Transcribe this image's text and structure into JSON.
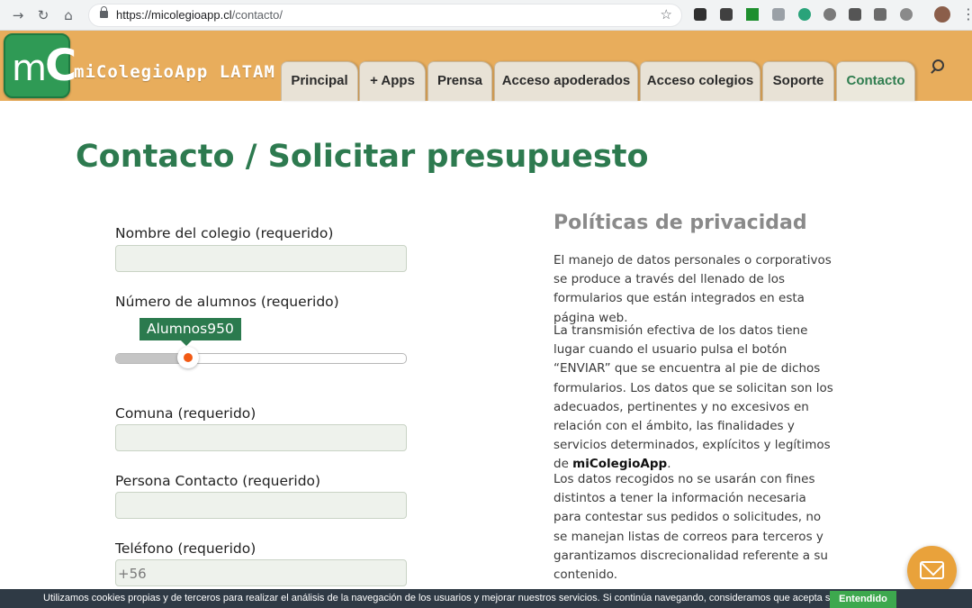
{
  "browser": {
    "url_host": "https://micolegioapp.cl",
    "url_path": "/contacto/",
    "back_icon": "back-arrow-icon",
    "reload_icon": "reload-icon",
    "home_icon": "home-icon"
  },
  "site": {
    "logo_letters_small": "m",
    "logo_letters_big": "C",
    "brand_name": "miColegioApp LATAM",
    "nav": [
      {
        "label": "Principal"
      },
      {
        "label": "+ Apps"
      },
      {
        "label": "Prensa"
      },
      {
        "label": "Acceso apoderados"
      },
      {
        "label": "Acceso colegios"
      },
      {
        "label": "Soporte"
      },
      {
        "label": "Contacto",
        "active": true
      }
    ]
  },
  "page": {
    "title": "Contacto / Solicitar presupuesto"
  },
  "form": {
    "school_name_label": "Nombre del colegio (requerido)",
    "school_name_value": "",
    "students_label": "Número de alumnos (requerido)",
    "students_tooltip": "Alumnos950",
    "students_fraction": 0.25,
    "comuna_label": "Comuna (requerido)",
    "comuna_value": "",
    "contact_label": "Persona Contacto (requerido)",
    "contact_value": "",
    "phone_label": "Teléfono (requerido)",
    "phone_value": "+56"
  },
  "privacy": {
    "title": "Políticas de privacidad",
    "p1": "El manejo de datos personales o corporativos se produce a través del llenado de los formularios que están integrados en esta página web.",
    "p2_text": "La transmisión efectiva de los datos tiene lugar cuando el usuario pulsa el botón “ENVIAR” que se encuentra al pie de dichos formularios. Los datos que se solicitan son los adecuados, pertinentes y no excesivos en relación con el ámbito, las finalidades y servicios determinados, explícitos y legítimos de ",
    "p2_brand": "miColegioApp",
    "p2_end": ".",
    "p3": "Los datos recogidos no se usarán con fines distintos a tener la información necesaria para contestar sus pedidos o solicitudes, no se manejan listas de correos para terceros y garantizamos discrecionalidad referente a su contenido."
  },
  "cookie": {
    "text": "Utilizamos cookies propias y de terceros para realizar el análisis de la navegación de los usuarios y mejorar nuestros servicios. Si continúa navegando, consideramos que acepta su uso.",
    "button": "Entendido"
  },
  "colors": {
    "header_bg": "#e8ad5c",
    "title_green": "#2d7a4f",
    "slider_accent": "#f25a14",
    "cookie_bg": "#2f3a45",
    "cookie_button": "#3da84e"
  }
}
